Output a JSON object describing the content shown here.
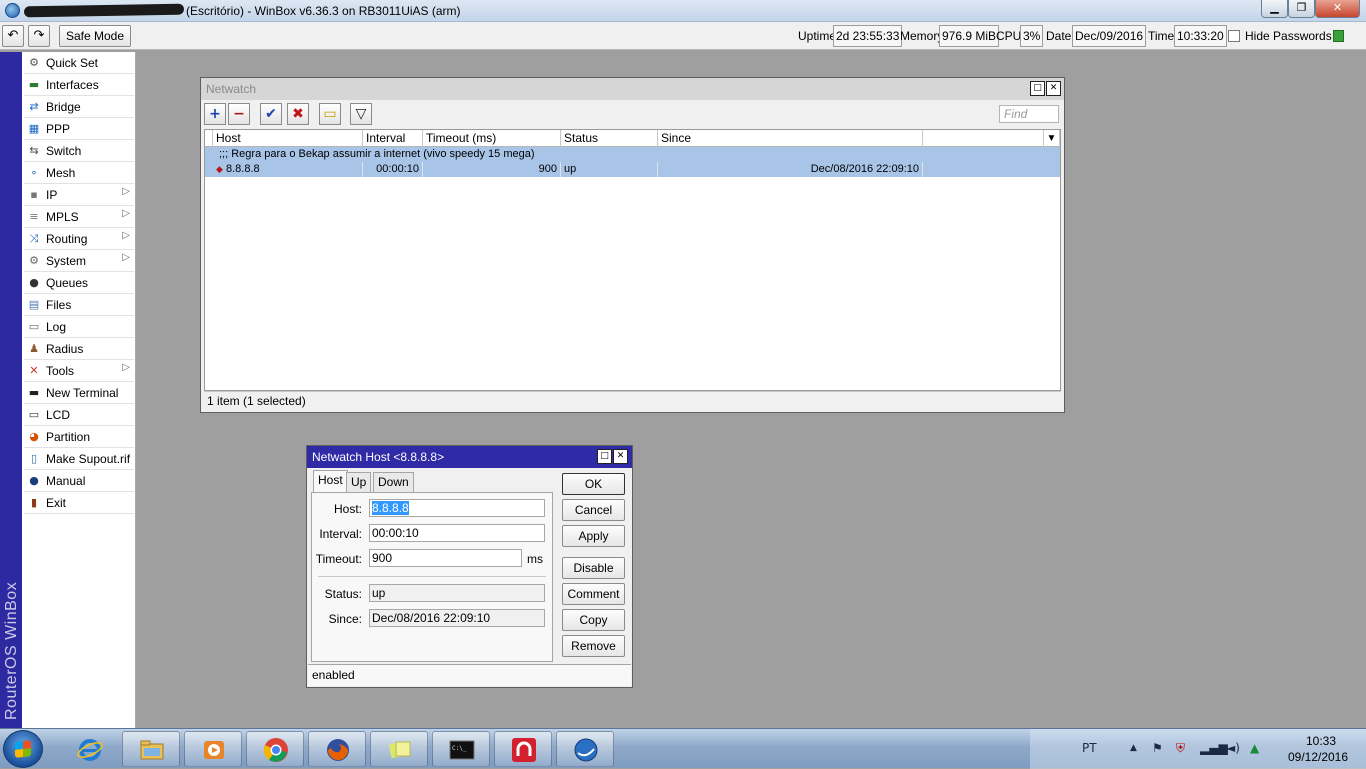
{
  "titlebar": {
    "title": "(Escritório) - WinBox v6.36.3 on RB3011UiAS (arm)",
    "minimize_glyph": "▁",
    "maximize_glyph": "❐",
    "close_glyph": "✕"
  },
  "toolbar": {
    "undo_glyph": "↶",
    "redo_glyph": "↷",
    "safe_mode": "Safe Mode",
    "uptime_label": "Uptime:",
    "uptime": "2d 23:55:33",
    "memory_label": "Memory:",
    "memory": "976.9 MiB",
    "cpu_label": "CPU:",
    "cpu": "3%",
    "date_label": "Date:",
    "date": "Dec/09/2016",
    "time_label": "Time:",
    "time": "10:33:20",
    "hide_passwords": "Hide Passwords"
  },
  "brand": "RouterOS WinBox",
  "sidebar": {
    "items": [
      {
        "label": "Quick Set",
        "icon": "quick-set-icon",
        "glyph": "⚙",
        "color": "#555555",
        "submenu": false
      },
      {
        "label": "Interfaces",
        "icon": "interfaces-icon",
        "glyph": "▬",
        "color": "#2e7d32",
        "submenu": false
      },
      {
        "label": "Bridge",
        "icon": "bridge-icon",
        "glyph": "⇄",
        "color": "#1565c0",
        "submenu": false
      },
      {
        "label": "PPP",
        "icon": "ppp-icon",
        "glyph": "▦",
        "color": "#1565c0",
        "submenu": false
      },
      {
        "label": "Switch",
        "icon": "switch-icon",
        "glyph": "⇆",
        "color": "#444444",
        "submenu": false
      },
      {
        "label": "Mesh",
        "icon": "mesh-icon",
        "glyph": "∘",
        "color": "#1565c0",
        "submenu": false
      },
      {
        "label": "IP",
        "icon": "ip-icon",
        "glyph": "▪",
        "color": "#777777",
        "submenu": true
      },
      {
        "label": "MPLS",
        "icon": "mpls-icon",
        "glyph": "≡",
        "color": "#777777",
        "submenu": true
      },
      {
        "label": "Routing",
        "icon": "routing-icon",
        "glyph": "⤨",
        "color": "#1565c0",
        "submenu": true
      },
      {
        "label": "System",
        "icon": "system-icon",
        "glyph": "⚙",
        "color": "#666666",
        "submenu": true
      },
      {
        "label": "Queues",
        "icon": "queues-icon",
        "glyph": "●",
        "color": "#333333",
        "submenu": false
      },
      {
        "label": "Files",
        "icon": "files-icon",
        "glyph": "▤",
        "color": "#4a7ab5",
        "submenu": false
      },
      {
        "label": "Log",
        "icon": "log-icon",
        "glyph": "▭",
        "color": "#666666",
        "submenu": false
      },
      {
        "label": "Radius",
        "icon": "radius-icon",
        "glyph": "♟",
        "color": "#8a5a2b",
        "submenu": false
      },
      {
        "label": "Tools",
        "icon": "tools-icon",
        "glyph": "✕",
        "color": "#c0392b",
        "submenu": true
      },
      {
        "label": "New Terminal",
        "icon": "terminal-icon",
        "glyph": "▬",
        "color": "#222222",
        "submenu": false
      },
      {
        "label": "LCD",
        "icon": "lcd-icon",
        "glyph": "▭",
        "color": "#333333",
        "submenu": false
      },
      {
        "label": "Partition",
        "icon": "partition-icon",
        "glyph": "◕",
        "color": "#d35400",
        "submenu": false
      },
      {
        "label": "Make Supout.rif",
        "icon": "supout-icon",
        "glyph": "▯",
        "color": "#2e6da4",
        "submenu": false
      },
      {
        "label": "Manual",
        "icon": "manual-icon",
        "glyph": "●",
        "color": "#1a3d7c",
        "submenu": false
      },
      {
        "label": "Exit",
        "icon": "exit-icon",
        "glyph": "▮",
        "color": "#8b3a1a",
        "submenu": false
      }
    ]
  },
  "netwatch": {
    "title": "Netwatch",
    "find_placeholder": "Find",
    "columns": [
      "Host",
      "Interval",
      "Timeout (ms)",
      "Status",
      "Since"
    ],
    "comment": ";;; Regra para o Bekap assumir a internet (vivo speedy 15 mega)",
    "row": {
      "host": "8.8.8.8",
      "interval": "00:00:10",
      "timeout": "900",
      "status": "up",
      "since": "Dec/08/2016 22:09:10"
    },
    "status_bar": "1 item (1 selected)",
    "toolbar": {
      "add": "+",
      "remove": "−",
      "enable": "✔",
      "disable": "✖",
      "comment": "▭",
      "filter": "▽"
    }
  },
  "host_dialog": {
    "title": "Netwatch Host <8.8.8.8>",
    "tabs": [
      "Host",
      "Up",
      "Down"
    ],
    "fields": {
      "host_label": "Host:",
      "host": "8.8.8.8",
      "interval_label": "Interval:",
      "interval": "00:00:10",
      "timeout_label": "Timeout:",
      "timeout": "900",
      "timeout_unit": "ms",
      "status_label": "Status:",
      "status": "up",
      "since_label": "Since:",
      "since": "Dec/08/2016 22:09:10"
    },
    "buttons": [
      "OK",
      "Cancel",
      "Apply",
      "Disable",
      "Comment",
      "Copy",
      "Remove"
    ],
    "status_bar": "enabled"
  },
  "taskbar": {
    "apps": [
      {
        "name": "explorer",
        "icon": "internet-explorer-icon"
      },
      {
        "name": "file-explorer",
        "icon": "folder-icon"
      },
      {
        "name": "media-player",
        "icon": "media-player-icon"
      },
      {
        "name": "chrome",
        "icon": "chrome-icon"
      },
      {
        "name": "firefox",
        "icon": "firefox-icon"
      },
      {
        "name": "sticky-notes",
        "icon": "sticky-notes-icon"
      },
      {
        "name": "terminal",
        "icon": "command-prompt-icon"
      },
      {
        "name": "red-app",
        "icon": "red-app-icon"
      },
      {
        "name": "winbox",
        "icon": "winbox-icon"
      }
    ],
    "language": "PT",
    "clock_time": "10:33",
    "clock_date": "09/12/2016"
  }
}
